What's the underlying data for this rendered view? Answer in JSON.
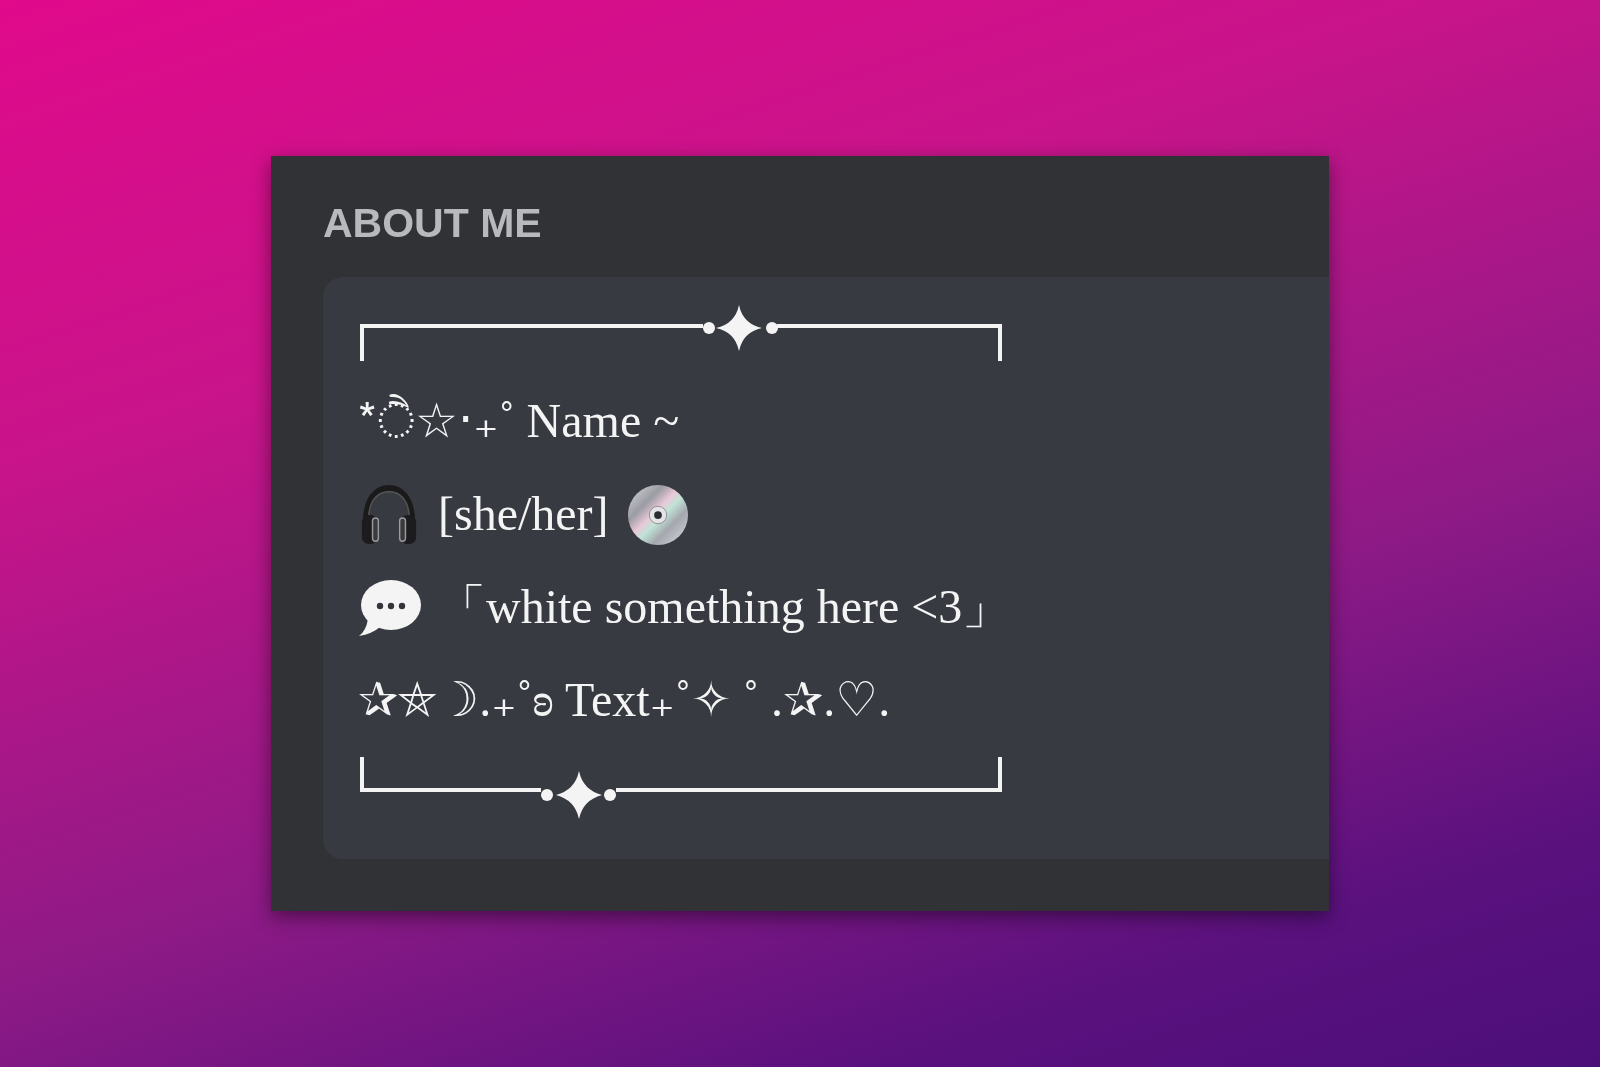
{
  "profile_card": {
    "heading": "ABOUT ME",
    "bio_lines": [
      {
        "kind": "plain",
        "text": "*ੈ☆‧₊˚ Name ~"
      },
      {
        "kind": "music",
        "text": "[she/her]"
      },
      {
        "kind": "chat",
        "text": "「white something here <3」"
      },
      {
        "kind": "plain",
        "text": "✰⛤☽.₊˚ʚ Text₊˚✧ ˚ .✰.♡."
      }
    ]
  }
}
